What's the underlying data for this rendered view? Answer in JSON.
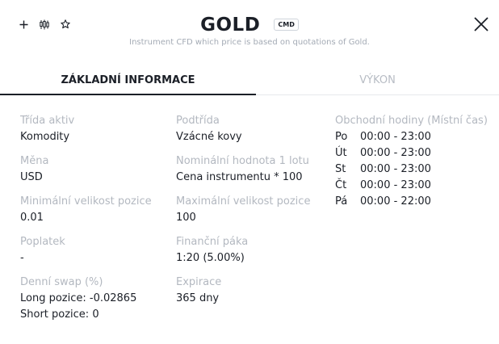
{
  "header": {
    "title": "GOLD",
    "badge": "CMD",
    "subtitle": "Instrument CFD which price is based on quotations of Gold."
  },
  "toolbar": {
    "icons": [
      "plus-icon",
      "candlestick-chart-icon",
      "star-icon",
      "close-icon"
    ]
  },
  "tabs": [
    {
      "label": "ZÁKLADNÍ INFORMACE",
      "active": true
    },
    {
      "label": "VÝKON",
      "active": false
    }
  ],
  "info": {
    "asset_class": {
      "label": "Třída aktiv",
      "value": "Komodity"
    },
    "currency": {
      "label": "Měna",
      "value": "USD"
    },
    "min_position": {
      "label": "Minimální velikost pozice",
      "value": "0.01"
    },
    "fee": {
      "label": "Poplatek",
      "value": "-"
    },
    "daily_swap": {
      "label": "Denní swap (%)",
      "long": "Long pozice: -0.02865",
      "short": "Short pozice: 0"
    },
    "subclass": {
      "label": "Podtřída",
      "value": "Vzácné kovy"
    },
    "nominal": {
      "label": "Nominální hodnota 1 lotu",
      "value": "Cena instrumentu * 100"
    },
    "max_position": {
      "label": "Maximální velikost pozice",
      "value": "100"
    },
    "leverage": {
      "label": "Finanční páka",
      "value": "1:20 (5.00%)"
    },
    "expiration": {
      "label": "Expirace",
      "value": "365 dny"
    }
  },
  "trading_hours": {
    "label": "Obchodní hodiny (Místní čas)",
    "rows": [
      {
        "day": "Po",
        "hours": "00:00 - 23:00"
      },
      {
        "day": "Út",
        "hours": "00:00 - 23:00"
      },
      {
        "day": "St",
        "hours": "00:00 - 23:00"
      },
      {
        "day": "Čt",
        "hours": "00:00 - 23:00"
      },
      {
        "day": "Pá",
        "hours": "00:00 - 22:00"
      }
    ]
  }
}
